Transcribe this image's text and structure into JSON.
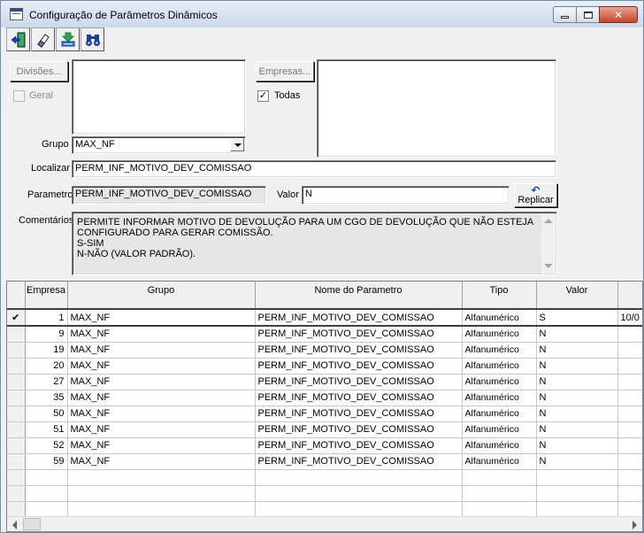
{
  "window": {
    "title": "Configuração de Parâmetros Dinâmicos",
    "buttons": {
      "minimize": "minimize",
      "maximize": "maximize",
      "close": "✕"
    }
  },
  "toolbar": {
    "icons": [
      "exit-icon",
      "eraser-icon",
      "download-save-icon",
      "binoculars-search-icon"
    ]
  },
  "filters": {
    "divisoes_button": "Divisões...",
    "geral_label": "Geral",
    "geral_checked": false,
    "empresas_button": "Empresas...",
    "todas_label": "Todas",
    "todas_checked": true,
    "todas_tick": "✓",
    "grupo_label": "Grupo",
    "grupo_value": "MAX_NF",
    "localizar_label": "Localizar",
    "localizar_value": "PERM_INF_MOTIVO_DEV_COMISSAO"
  },
  "details": {
    "parametro_label": "Parametro",
    "parametro_value": "PERM_INF_MOTIVO_DEV_COMISSAO",
    "valor_label": "Valor",
    "valor_value": "N",
    "replicar_button": "Replicar",
    "replicar_icon": "↶",
    "comentarios_label": "Comentários",
    "comentarios_lines": [
      "PERMITE INFORMAR MOTIVO DE DEVOLUÇÃO PARA UM CGO DE DEVOLUÇÃO QUE NÃO ESTEJA",
      "CONFIGURADO PARA GERAR COMISSÃO.",
      "S-SIM",
      "N-NÃO (VALOR PADRÃO)."
    ]
  },
  "grid": {
    "columns": [
      "",
      "Empresa",
      "Grupo",
      "Nome do Parametro",
      "Tipo",
      "Valor",
      ""
    ],
    "current_marker": "✔",
    "current_extra": "10/0",
    "rows": [
      {
        "empresa": "1",
        "grupo": "MAX_NF",
        "nome": "PERM_INF_MOTIVO_DEV_COMISSAO",
        "tipo": "Alfanumérico",
        "valor": "S"
      },
      {
        "empresa": "9",
        "grupo": "MAX_NF",
        "nome": "PERM_INF_MOTIVO_DEV_COMISSAO",
        "tipo": "Alfanumérico",
        "valor": "N"
      },
      {
        "empresa": "19",
        "grupo": "MAX_NF",
        "nome": "PERM_INF_MOTIVO_DEV_COMISSAO",
        "tipo": "Alfanumérico",
        "valor": "N"
      },
      {
        "empresa": "20",
        "grupo": "MAX_NF",
        "nome": "PERM_INF_MOTIVO_DEV_COMISSAO",
        "tipo": "Alfanumérico",
        "valor": "N"
      },
      {
        "empresa": "27",
        "grupo": "MAX_NF",
        "nome": "PERM_INF_MOTIVO_DEV_COMISSAO",
        "tipo": "Alfanumérico",
        "valor": "N"
      },
      {
        "empresa": "35",
        "grupo": "MAX_NF",
        "nome": "PERM_INF_MOTIVO_DEV_COMISSAO",
        "tipo": "Alfanumérico",
        "valor": "N"
      },
      {
        "empresa": "50",
        "grupo": "MAX_NF",
        "nome": "PERM_INF_MOTIVO_DEV_COMISSAO",
        "tipo": "Alfanumérico",
        "valor": "N"
      },
      {
        "empresa": "51",
        "grupo": "MAX_NF",
        "nome": "PERM_INF_MOTIVO_DEV_COMISSAO",
        "tipo": "Alfanumérico",
        "valor": "N"
      },
      {
        "empresa": "52",
        "grupo": "MAX_NF",
        "nome": "PERM_INF_MOTIVO_DEV_COMISSAO",
        "tipo": "Alfanumérico",
        "valor": "N"
      },
      {
        "empresa": "59",
        "grupo": "MAX_NF",
        "nome": "PERM_INF_MOTIVO_DEV_COMISSAO",
        "tipo": "Alfanumérico",
        "valor": "N"
      }
    ]
  }
}
